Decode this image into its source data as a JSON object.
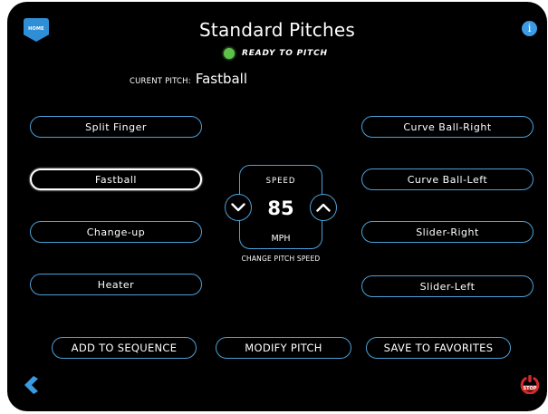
{
  "header": {
    "home_label": "HOME",
    "title": "Standard Pitches",
    "info_icon": "i"
  },
  "status": {
    "text": "READY TO PITCH",
    "color": "#5cc24a"
  },
  "current_pitch": {
    "label": "CURENT PITCH:",
    "value": "Fastball"
  },
  "left_pitches": [
    {
      "label": "Split Finger"
    },
    {
      "label": "Fastball",
      "selected": true
    },
    {
      "label": "Change-up"
    },
    {
      "label": "Heater"
    }
  ],
  "right_pitches": [
    {
      "label": "Curve Ball-Right"
    },
    {
      "label": "Curve Ball-Left"
    },
    {
      "label": "Slider-Right"
    },
    {
      "label": "Slider-Left"
    }
  ],
  "speed": {
    "label": "SPEED",
    "value": "85",
    "unit": "MPH",
    "change_label": "CHANGE PITCH SPEED"
  },
  "actions": {
    "add_to_sequence": "ADD TO SEQUENCE",
    "modify_pitch": "MODIFY PITCH",
    "save_to_favorites": "SAVE TO FAVORITES"
  },
  "footer": {
    "stop_label": "STOP"
  },
  "colors": {
    "accent": "#4ca0d8",
    "stop": "#d22b2b",
    "back": "#3a9be0"
  }
}
